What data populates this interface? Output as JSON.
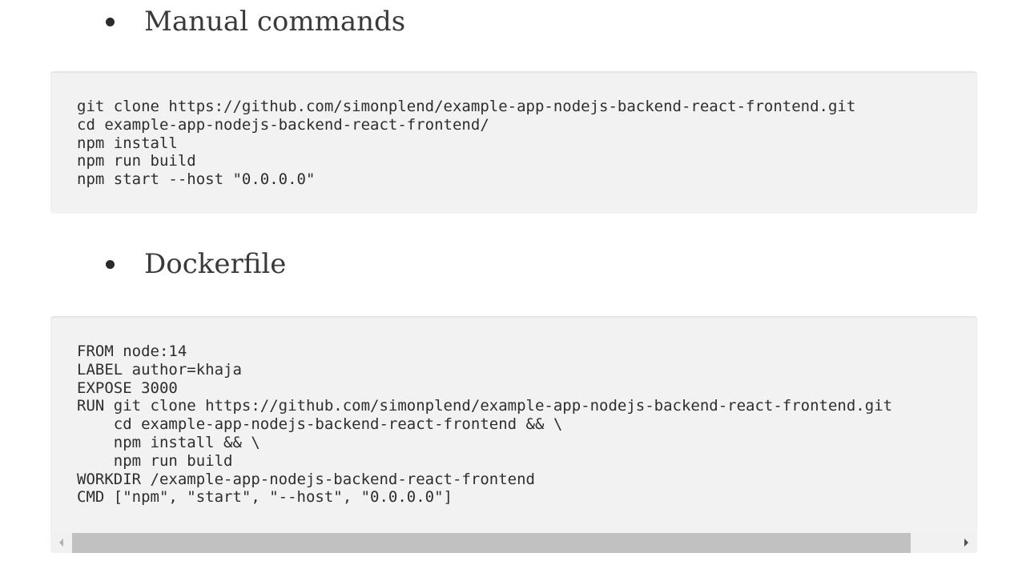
{
  "sections": [
    {
      "heading": "Manual commands",
      "code_lines": [
        "git clone https://github.com/simonplend/example-app-nodejs-backend-react-frontend.git",
        "cd example-app-nodejs-backend-react-frontend/",
        "npm install",
        "npm run build",
        "npm start --host \"0.0.0.0\""
      ]
    },
    {
      "heading": "Dockerfile",
      "code_lines": [
        "FROM node:14",
        "LABEL author=khaja",
        "EXPOSE 3000",
        "RUN git clone https://github.com/simonplend/example-app-nodejs-backend-react-frontend.git",
        "    cd example-app-nodejs-backend-react-frontend && \\",
        "    npm install && \\",
        "    npm run build",
        "WORKDIR /example-app-nodejs-backend-react-frontend",
        "CMD [\"npm\", \"start\", \"--host\", \"0.0.0.0\"]"
      ],
      "scrollbar": {
        "position_fraction": 0.0,
        "visible_fraction": 0.93
      }
    }
  ],
  "colors": {
    "code_background": "#f2f2f2",
    "scroll_thumb": "#c1c1c1",
    "text": "#333333"
  },
  "icons": {
    "bullet": "bullet-dot-icon",
    "scroll_left": "triangle-left-icon",
    "scroll_right": "triangle-right-icon"
  }
}
